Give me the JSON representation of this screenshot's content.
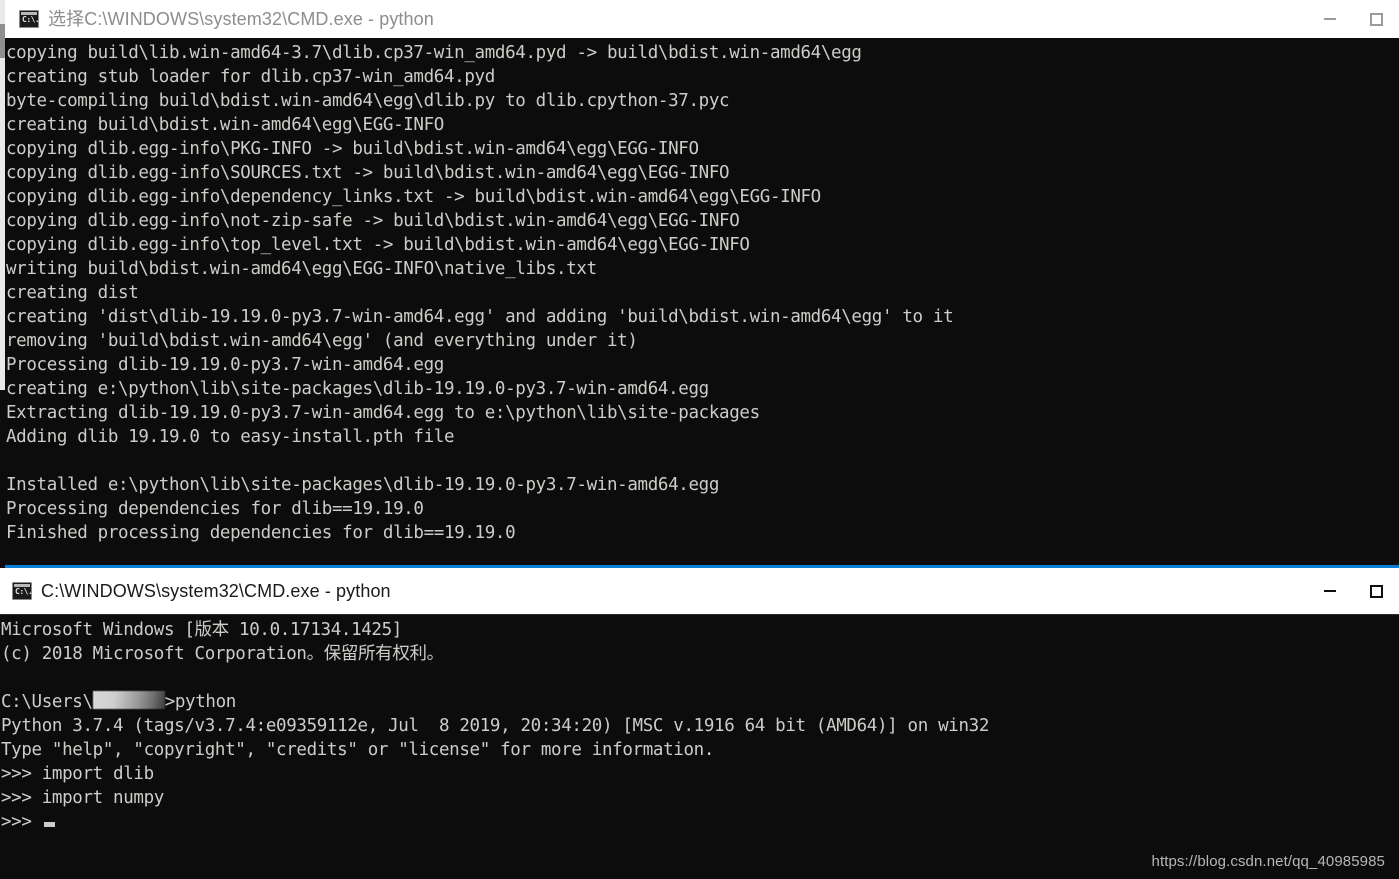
{
  "windows": [
    {
      "id": "top",
      "title": "选择C:\\WINDOWS\\system32\\CMD.exe - python",
      "icon": "console-icon",
      "icon_label": "C:\\.",
      "active": false,
      "accent_color": "#0a7fd8",
      "controls": {
        "minimize": "minimize-button",
        "maximize": "maximize-button"
      },
      "lines": [
        "copying build\\lib.win-amd64-3.7\\dlib.cp37-win_amd64.pyd -> build\\bdist.win-amd64\\egg",
        "creating stub loader for dlib.cp37-win_amd64.pyd",
        "byte-compiling build\\bdist.win-amd64\\egg\\dlib.py to dlib.cpython-37.pyc",
        "creating build\\bdist.win-amd64\\egg\\EGG-INFO",
        "copying dlib.egg-info\\PKG-INFO -> build\\bdist.win-amd64\\egg\\EGG-INFO",
        "copying dlib.egg-info\\SOURCES.txt -> build\\bdist.win-amd64\\egg\\EGG-INFO",
        "copying dlib.egg-info\\dependency_links.txt -> build\\bdist.win-amd64\\egg\\EGG-INFO",
        "copying dlib.egg-info\\not-zip-safe -> build\\bdist.win-amd64\\egg\\EGG-INFO",
        "copying dlib.egg-info\\top_level.txt -> build\\bdist.win-amd64\\egg\\EGG-INFO",
        "writing build\\bdist.win-amd64\\egg\\EGG-INFO\\native_libs.txt",
        "creating dist",
        "creating 'dist\\dlib-19.19.0-py3.7-win-amd64.egg' and adding 'build\\bdist.win-amd64\\egg' to it",
        "removing 'build\\bdist.win-amd64\\egg' (and everything under it)",
        "Processing dlib-19.19.0-py3.7-win-amd64.egg",
        "creating e:\\python\\lib\\site-packages\\dlib-19.19.0-py3.7-win-amd64.egg",
        "Extracting dlib-19.19.0-py3.7-win-amd64.egg to e:\\python\\lib\\site-packages",
        "Adding dlib 19.19.0 to easy-install.pth file",
        "",
        "Installed e:\\python\\lib\\site-packages\\dlib-19.19.0-py3.7-win-amd64.egg",
        "Processing dependencies for dlib==19.19.0",
        "Finished processing dependencies for dlib==19.19.0"
      ]
    },
    {
      "id": "bottom",
      "title": "C:\\WINDOWS\\system32\\CMD.exe - python",
      "icon": "console-icon",
      "icon_label": "C:\\.",
      "active": true,
      "controls": {
        "minimize": "minimize-button",
        "maximize": "maximize-button"
      },
      "lines_before_prompt": [
        "Microsoft Windows [版本 10.0.17134.1425]",
        "(c) 2018 Microsoft Corporation。保留所有权利。",
        ""
      ],
      "prompt_line": {
        "prefix": "C:\\Users\\",
        "redacted_user": "",
        "suffix": ">python"
      },
      "lines_after_prompt": [
        "Python 3.7.4 (tags/v3.7.4:e09359112e, Jul  8 2019, 20:34:20) [MSC v.1916 64 bit (AMD64)] on win32",
        "Type \"help\", \"copyright\", \"credits\" or \"license\" for more information.",
        ">>> import dlib",
        ">>> import numpy"
      ],
      "final_prompt": ">>> "
    }
  ],
  "watermark": "https://blog.csdn.net/qq_40985985"
}
